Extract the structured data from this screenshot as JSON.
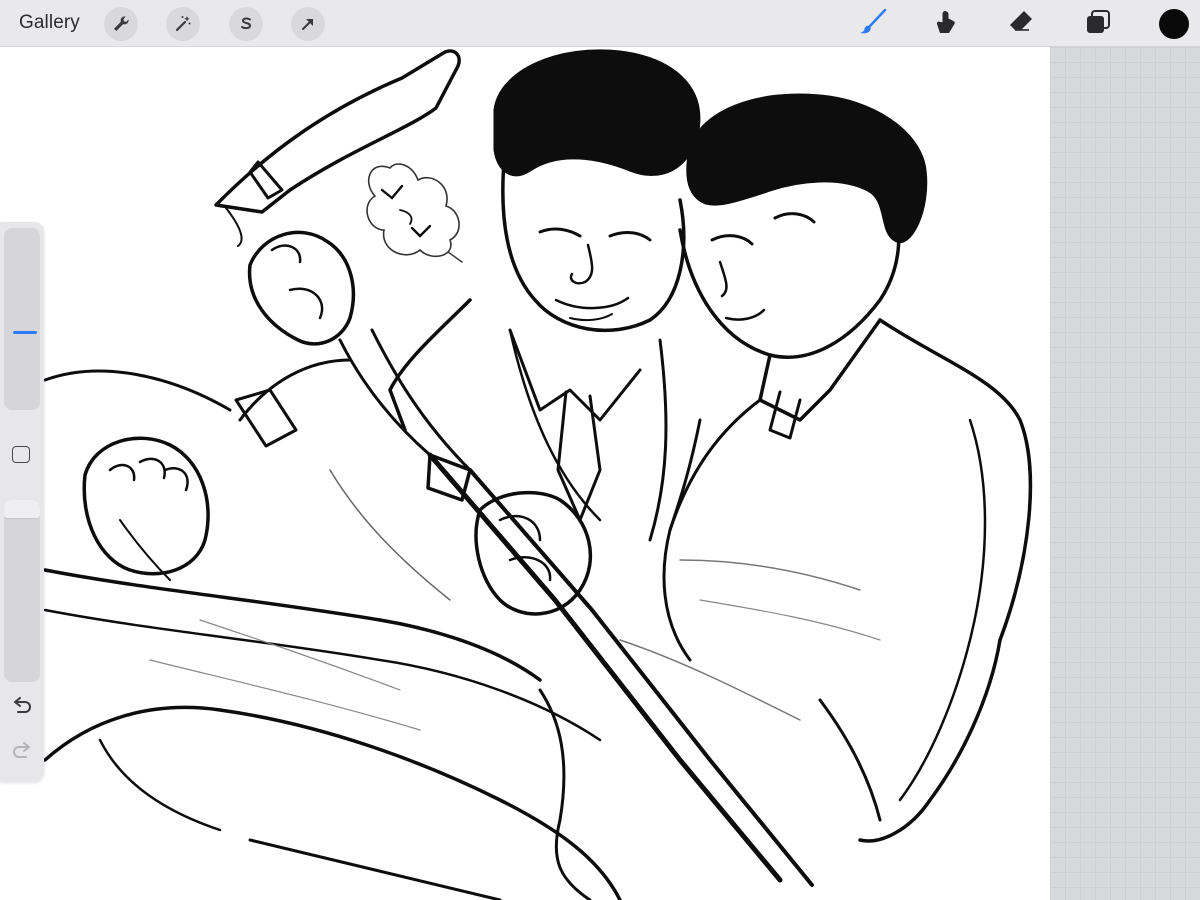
{
  "toolbar": {
    "gallery_label": "Gallery",
    "left_tools": [
      "wrench-icon",
      "magic-wand-icon",
      "selection-s-icon",
      "transform-arrow-icon"
    ],
    "right_tools": [
      "brush-icon",
      "smudge-icon",
      "eraser-icon",
      "layers-icon"
    ],
    "active_tool": "brush-icon",
    "accent_color": "#2f7bf6",
    "current_color": "#0a0a0a"
  },
  "sidebar": {
    "brush_size": 0.42,
    "brush_opacity": 1.0,
    "controls": [
      "brush-size-slider",
      "modifier-square",
      "brush-opacity-slider",
      "undo-icon",
      "redo-icon"
    ]
  },
  "canvas": {
    "background": "#ffffff",
    "ink": "#0d0d0d",
    "grid_color": "#d8d9dc"
  }
}
